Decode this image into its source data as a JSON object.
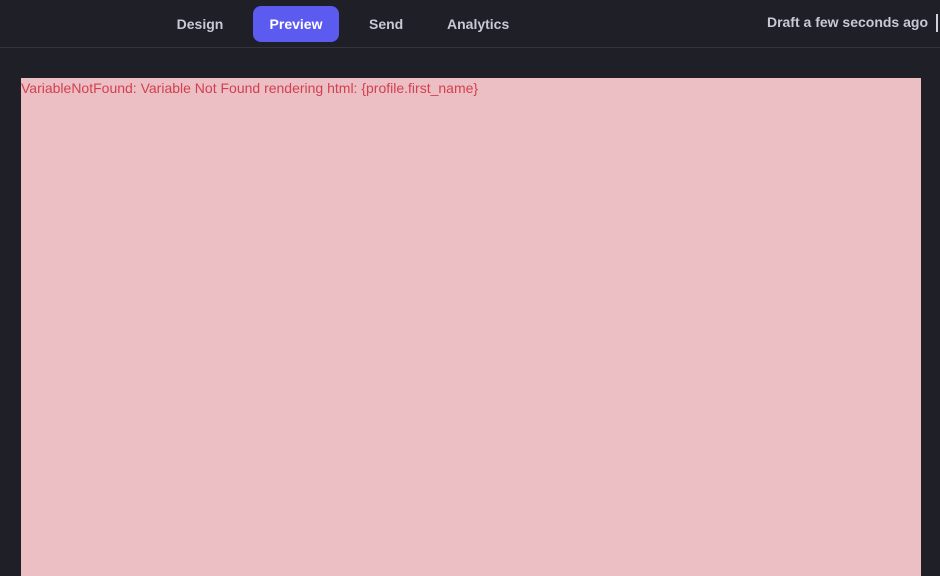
{
  "tabs": [
    {
      "label": "Design",
      "active": false
    },
    {
      "label": "Preview",
      "active": true
    },
    {
      "label": "Send",
      "active": false
    },
    {
      "label": "Analytics",
      "active": false
    }
  ],
  "status": "Draft a few seconds ago",
  "preview": {
    "error_message": "VariableNotFound: Variable Not Found rendering html: {profile.first_name}"
  },
  "colors": {
    "background": "#1f1f28",
    "accent": "#5b5bf0",
    "preview_background": "#ecbfc5",
    "error_text": "#d2404f"
  }
}
